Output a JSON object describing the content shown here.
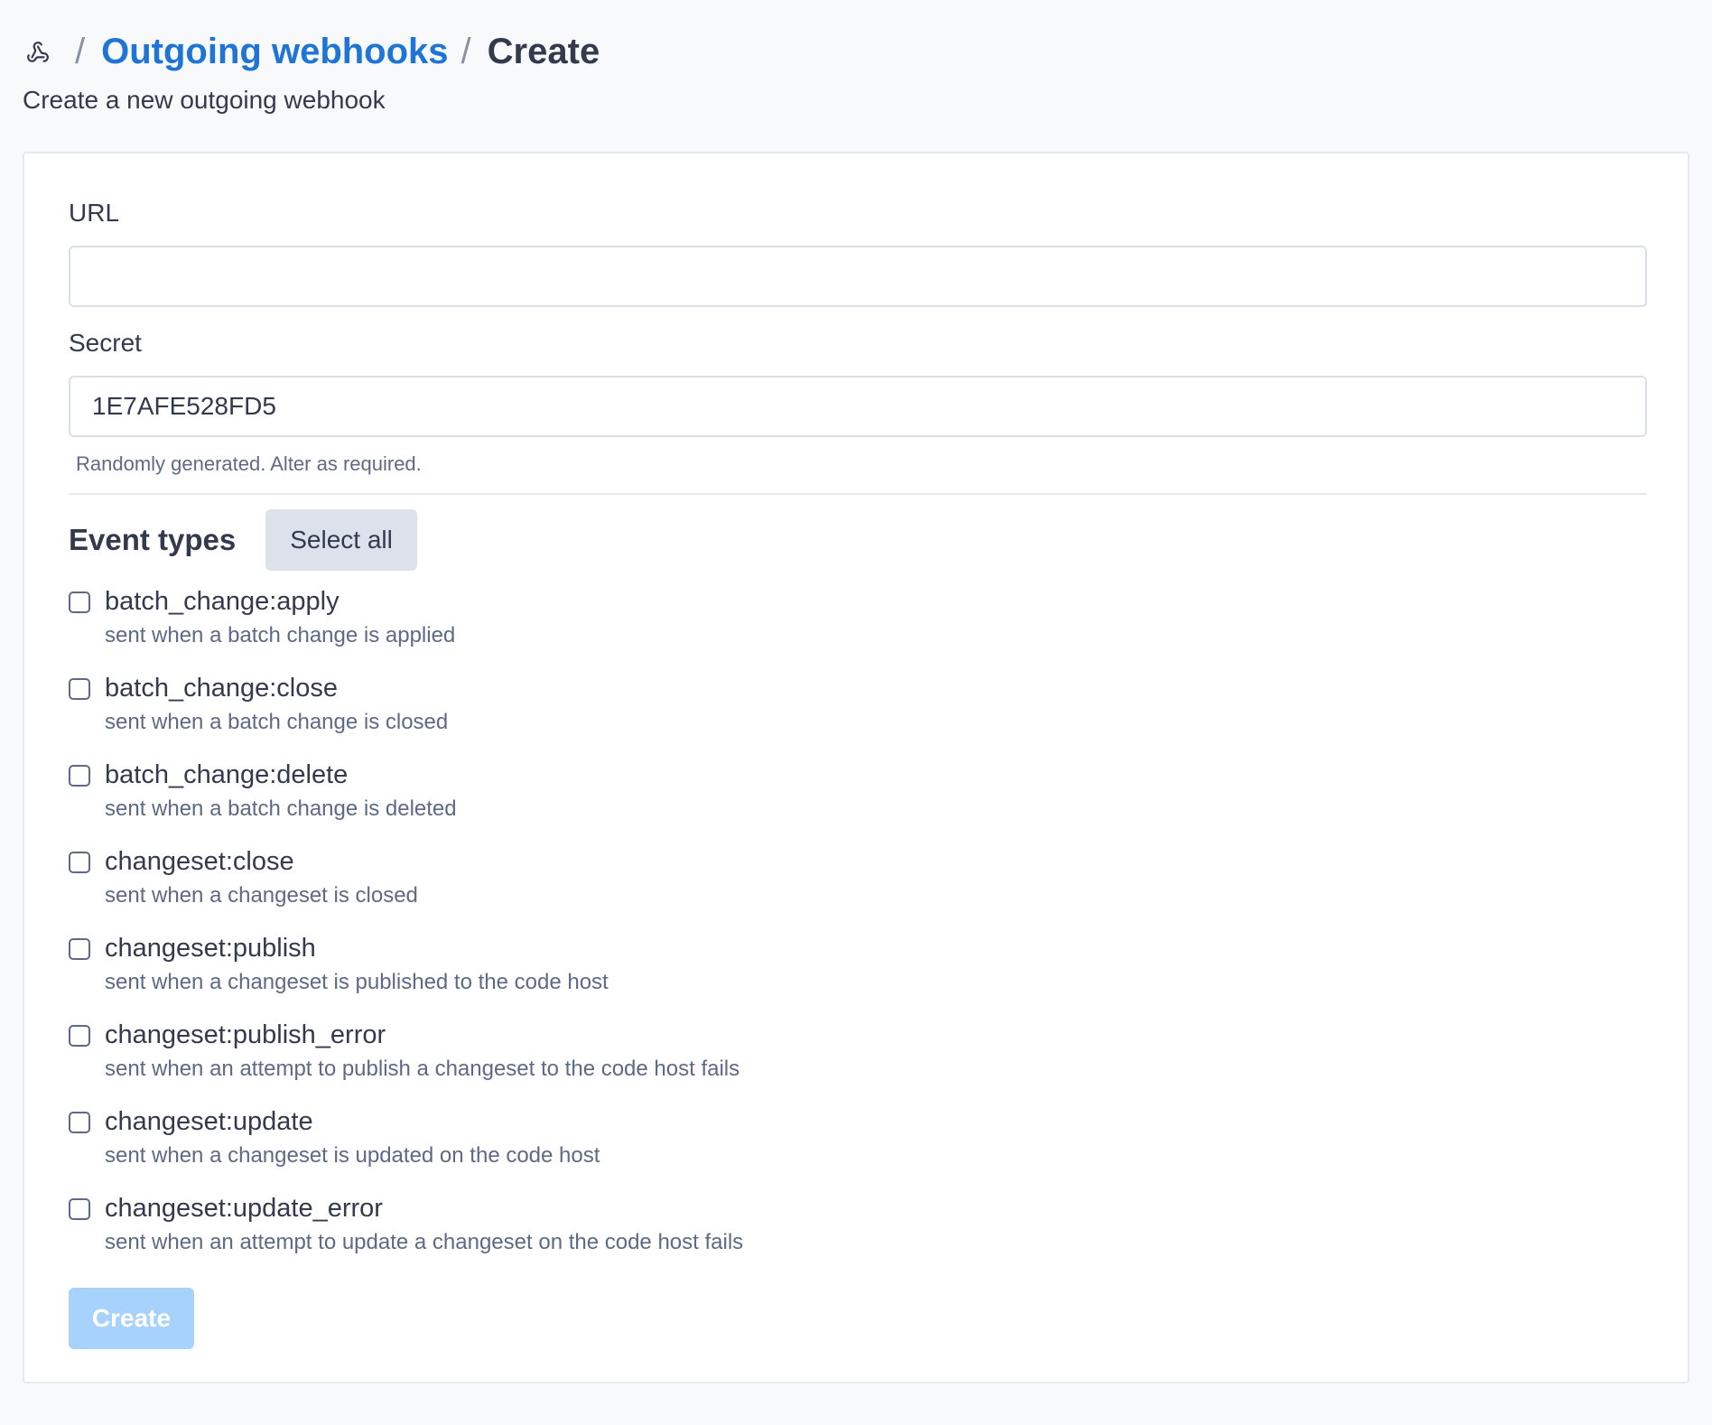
{
  "breadcrumb": {
    "icon": "webhooks-icon",
    "separator": "/",
    "parent_label": "Outgoing webhooks",
    "current_label": "Create"
  },
  "subtitle": "Create a new outgoing webhook",
  "form": {
    "url_label": "URL",
    "url_value": "",
    "secret_label": "Secret",
    "secret_value": "1E7AFE528FD5",
    "secret_help": "Randomly generated. Alter as required.",
    "events_title": "Event types",
    "select_all_label": "Select all",
    "events": [
      {
        "name": "batch_change:apply",
        "description": "sent when a batch change is applied",
        "checked": false
      },
      {
        "name": "batch_change:close",
        "description": "sent when a batch change is closed",
        "checked": false
      },
      {
        "name": "batch_change:delete",
        "description": "sent when a batch change is deleted",
        "checked": false
      },
      {
        "name": "changeset:close",
        "description": "sent when a changeset is closed",
        "checked": false
      },
      {
        "name": "changeset:publish",
        "description": "sent when a changeset is published to the code host",
        "checked": false
      },
      {
        "name": "changeset:publish_error",
        "description": "sent when an attempt to publish a changeset to the code host fails",
        "checked": false
      },
      {
        "name": "changeset:update",
        "description": "sent when a changeset is updated on the code host",
        "checked": false
      },
      {
        "name": "changeset:update_error",
        "description": "sent when an attempt to update a changeset on the code host fails",
        "checked": false
      }
    ],
    "create_label": "Create",
    "create_disabled": true
  },
  "colors": {
    "link": "#1f75d6",
    "create_disabled_bg": "#a6d2fb",
    "select_all_bg": "#dde1ec"
  }
}
